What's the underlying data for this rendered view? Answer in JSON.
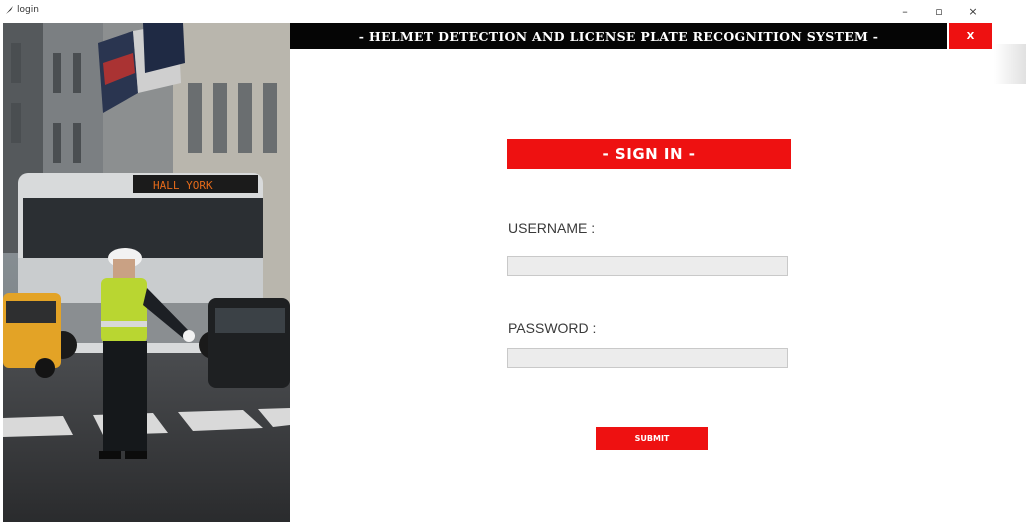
{
  "window": {
    "title": "login",
    "minimize": "–",
    "maximize": "▫",
    "close": "×"
  },
  "header": {
    "banner": "- HELMET DETECTION AND LICENSE PLATE RECOGNITION SYSTEM -",
    "exit_label": "X"
  },
  "photo": {
    "bus_sign": "HALL YORK",
    "description_icon": "traffic-police-photo"
  },
  "form": {
    "heading": "- SIGN IN -",
    "username_label": "USERNAME :",
    "username_value": "",
    "password_label": "PASSWORD :",
    "password_value": "",
    "submit_label": "SUBMIT"
  },
  "colors": {
    "accent": "#ee1111",
    "banner_bg": "#050505",
    "input_bg": "#ececec"
  }
}
